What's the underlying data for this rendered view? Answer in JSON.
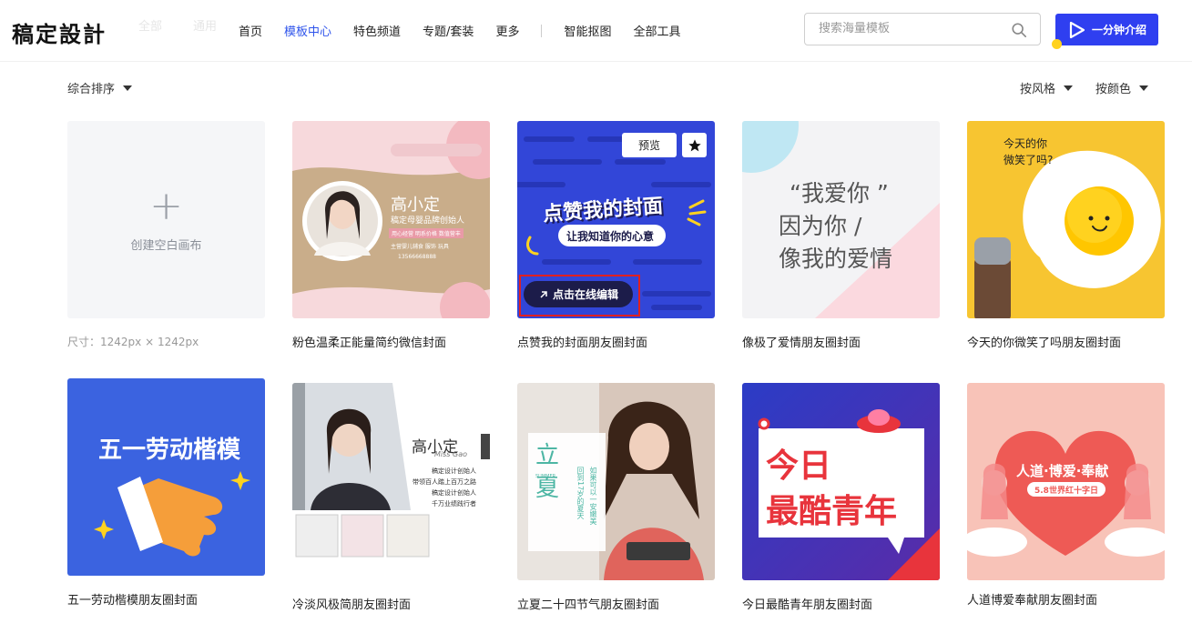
{
  "header": {
    "logo": "稿定設計",
    "ghost_left": "全部",
    "ghost_right": "通用",
    "nav": [
      {
        "label": "首页",
        "active": false
      },
      {
        "label": "模板中心",
        "active": true
      },
      {
        "label": "特色频道",
        "active": false
      },
      {
        "label": "专题/套装",
        "active": false
      },
      {
        "label": "更多",
        "active": false
      }
    ],
    "nav_tools": [
      {
        "label": "智能抠图"
      },
      {
        "label": "全部工具"
      }
    ],
    "search_placeholder": "搜索海量模板",
    "intro_button": "一分钟介绍"
  },
  "filters": {
    "sort": "综合排序",
    "style": "按风格",
    "color": "按颜色"
  },
  "blank_card": {
    "label": "创建空白画布",
    "size": "尺寸：1242px × 1242px"
  },
  "templates_row1": [
    {
      "title": "粉色温柔正能量简约微信封面",
      "name": "高小定",
      "subtitle": "稿定母婴品牌创始人",
      "line1": "用心经营 明系价格 数值营丰",
      "line2": "主营婴儿辅食 服饰 玩具",
      "phone": "13566668888"
    },
    {
      "title": "点赞我的封面朋友圈封面",
      "headline": "点赞我的封面",
      "sub": "让我知道你的心意",
      "preview": "预览",
      "edit": "点击在线编辑"
    },
    {
      "title": "像极了爱情朋友圈封面",
      "lines": [
        "“我爱你 ”",
        "因为你 /",
        "像我的爱情"
      ]
    },
    {
      "title": "今天的你微笑了吗朋友圈封面",
      "text": "今天的你\n微笑了吗?"
    }
  ],
  "templates_row2": [
    {
      "title": "五一劳动楷模朋友圈封面",
      "headline": "五一劳动楷模"
    },
    {
      "title": "冷淡风极简朋友圈封面",
      "name": "高小定",
      "en": "Miss Gao",
      "lines": [
        "稿定设计创始人",
        "带领百人踏上百万之路",
        "稿定设计创始人",
        "千万业绩践行者"
      ]
    },
    {
      "title": "立夏二十四节气朋友圈封面",
      "big": "立夏",
      "small": "SUMMER",
      "col1": "回到17岁的夏天",
      "col2": "如果可以一安嫩美"
    },
    {
      "title": "今日最酷青年朋友圈封面",
      "line1": "今日",
      "line2": "最酷青年"
    },
    {
      "title": "人道博爱奉献朋友圈封面",
      "headline": "人道·博爱·奉献",
      "badge": "5.8世界红十字日"
    }
  ]
}
